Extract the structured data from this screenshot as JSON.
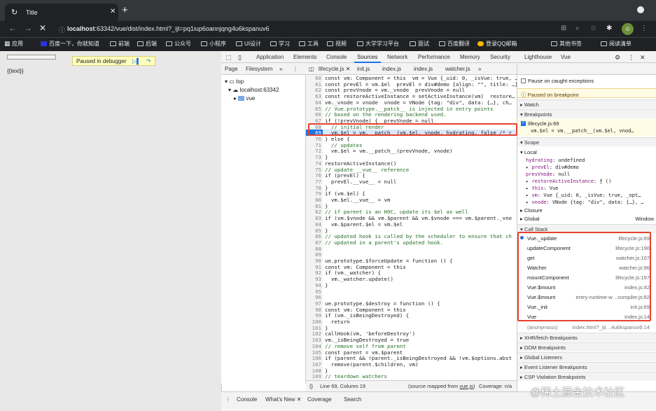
{
  "browser": {
    "tab_title": "Title",
    "url_host": "localhost",
    "url_rest": ":63342/vue/dist/index.html?_ijt=pq1iup6oannjqng4u6kspanuv6",
    "bookmarks": [
      "应用",
      "百度一下，你就知道",
      "前端",
      "后端",
      "公众号",
      "小程序",
      "UI设计",
      "学习",
      "工具",
      "视频",
      "大学学习平台",
      "面试",
      "百度翻译",
      "登录QQ邮箱"
    ],
    "other_bookmarks": "其他书签",
    "reading_list": "阅读清单"
  },
  "page": {
    "paused_label": "Paused in debugger",
    "body_text": "{{text}}"
  },
  "devtools": {
    "tabs": [
      "Application",
      "Elements",
      "Console",
      "Sources",
      "Network",
      "Performance",
      "Memory",
      "Security",
      "Lighthouse",
      "Vue"
    ],
    "active_tab": "Sources",
    "nav_tabs": [
      "Page",
      "Filesystem"
    ],
    "file_tabs": [
      "lifecycle.js",
      "init.js",
      "index.js",
      "index.js",
      "watcher.js"
    ],
    "tree": {
      "top": "top",
      "host": "localhost:63342",
      "folder": "vue"
    },
    "code_lines": [
      {
        "n": "60",
        "t": "const vm: Component = this  vm = Vue {_uid: 0, _isVue: true, …}"
      },
      {
        "n": "61",
        "t": "const prevEl = vm.$el  prevEl = div#demo {align: \"\", title: …}"
      },
      {
        "n": "62",
        "t": "const prevVnode = vm._vnode  prevVnode = null"
      },
      {
        "n": "63",
        "t": "const restoreActiveInstance = setActiveInstance(vm)  restore…"
      },
      {
        "n": "64",
        "t": "vm._vnode = vnode  vnode = VNode {tag: \"div\", data: {…}, ch…"
      },
      {
        "n": "65",
        "t": "// Vue.prototype.__patch__ is injected in entry points"
      },
      {
        "n": "66",
        "t": "// based on the rendering backend used."
      },
      {
        "n": "67",
        "t": "if (!prevVnode) {  prevVnode = null"
      },
      {
        "n": "68",
        "t": "  // initial render"
      },
      {
        "n": "69",
        "t": "  vm.$el = vm.__patch__(vm.$el, vnode, hydrating, false /* r"
      },
      {
        "n": "70",
        "t": "} else {"
      },
      {
        "n": "71",
        "t": "  // updates"
      },
      {
        "n": "72",
        "t": "  vm.$el = vm.__patch__(prevVnode, vnode)"
      },
      {
        "n": "73",
        "t": "}"
      },
      {
        "n": "74",
        "t": "restoreActiveInstance()"
      },
      {
        "n": "75",
        "t": "// update __vue__ reference"
      },
      {
        "n": "76",
        "t": "if (prevEl) {"
      },
      {
        "n": "77",
        "t": "  prevEl.__vue__ = null"
      },
      {
        "n": "78",
        "t": "}"
      },
      {
        "n": "79",
        "t": "if (vm.$el) {"
      },
      {
        "n": "80",
        "t": "  vm.$el.__vue__ = vm"
      },
      {
        "n": "81",
        "t": "}"
      },
      {
        "n": "82",
        "t": "// if parent is an HOC, update its $el as well"
      },
      {
        "n": "83",
        "t": "if (vm.$vnode && vm.$parent && vm.$vnode === vm.$parent._vno"
      },
      {
        "n": "84",
        "t": "  vm.$parent.$el = vm.$el"
      },
      {
        "n": "85",
        "t": "}"
      },
      {
        "n": "86",
        "t": "// updated hook is called by the scheduler to ensure that ch"
      },
      {
        "n": "87",
        "t": "// updated in a parent's updated hook."
      },
      {
        "n": "88",
        "t": ""
      },
      {
        "n": "89",
        "t": ""
      },
      {
        "n": "90",
        "t": "ue.prototype.$forceUpdate = function () {"
      },
      {
        "n": "91",
        "t": "const vm: Component = this"
      },
      {
        "n": "92",
        "t": "if (vm._watcher) {"
      },
      {
        "n": "93",
        "t": "  vm._watcher.update()"
      },
      {
        "n": "94",
        "t": "}"
      },
      {
        "n": "95",
        "t": ""
      },
      {
        "n": "96",
        "t": ""
      },
      {
        "n": "97",
        "t": "ue.prototype.$destroy = function () {"
      },
      {
        "n": "98",
        "t": "const vm: Component = this"
      },
      {
        "n": "99",
        "t": "if (vm._isBeingDestroyed) {"
      },
      {
        "n": "100",
        "t": "  return"
      },
      {
        "n": "101",
        "t": "}"
      },
      {
        "n": "102",
        "t": "callHook(vm, 'beforeDestroy')"
      },
      {
        "n": "103",
        "t": "vm._isBeingDestroyed = true"
      },
      {
        "n": "104",
        "t": "// remove self from parent"
      },
      {
        "n": "105",
        "t": "const parent = vm.$parent"
      },
      {
        "n": "106",
        "t": "if (parent && !parent._isBeingDestroyed && !vm.$options.abst"
      },
      {
        "n": "107",
        "t": "  remove(parent.$children, vm)"
      },
      {
        "n": "108",
        "t": "}"
      },
      {
        "n": "109",
        "t": "// teardown watchers"
      },
      {
        "n": "110",
        "t": "if (vm._watcher) {"
      },
      {
        "n": "111",
        "t": "  vm._watcher.teardown()"
      },
      {
        "n": "112",
        "t": "}"
      }
    ],
    "status": {
      "braces": "{}",
      "position": "Line 69, Column 19",
      "mapped": "(source mapped from ",
      "mapped_link": "vue.js",
      "mapped_end": ")",
      "coverage": "Coverage: n/a"
    },
    "right": {
      "pause_on_caught": "Pause on caught exceptions",
      "paused_on": "Paused on breakpoint",
      "watch": "Watch",
      "breakpoints": "Breakpoints",
      "bp_file": "lifecycle.js:69",
      "bp_code": "vm.$el = vm.__patch__(vm.$el, vnod…",
      "scope": "Scope",
      "local": "Local",
      "scope_items": [
        {
          "k": "hydrating",
          "v": ": undefined",
          "arrow": " "
        },
        {
          "k": "prevEl",
          "v": ": div#demo",
          "arrow": "▸"
        },
        {
          "k": "prevVnode",
          "v": ": null",
          "arrow": " "
        },
        {
          "k": "restoreActiveInstance",
          "v": ": ƒ ()",
          "arrow": "▸"
        },
        {
          "k": "this",
          "v": ": Vue",
          "arrow": "▸"
        },
        {
          "k": "vm",
          "v": ": Vue {_uid: 0, _isVue: true, _opt…",
          "arrow": "▸"
        },
        {
          "k": "vnode",
          "v": ": VNode {tag: \"div\", data: {…}, …",
          "arrow": "▸"
        }
      ],
      "closure": "Closure",
      "global": "Global",
      "global_val": "Window",
      "call_stack": "Call Stack",
      "frames": [
        {
          "fn": "Vue._update",
          "loc": "lifecycle.js:69"
        },
        {
          "fn": "updateComponent",
          "loc": "lifecycle.js:190"
        },
        {
          "fn": "get",
          "loc": "watcher.js:107"
        },
        {
          "fn": "Watcher",
          "loc": "watcher.js:96"
        },
        {
          "fn": "mountComponent",
          "loc": "lifecycle.js:197"
        },
        {
          "fn": "Vue.$mount",
          "loc": "index.js:42"
        },
        {
          "fn": "Vue.$mount",
          "loc": "entry-runtime-w…compiler.js:82"
        },
        {
          "fn": "Vue._init",
          "loc": "init.js:69"
        },
        {
          "fn": "Vue",
          "loc": "index.js:14"
        }
      ],
      "anon": "(anonymous)",
      "anon_loc": "index.html?_ijt…4u6kspanuv6:14",
      "more_sections": [
        "XHR/fetch Breakpoints",
        "DOM Breakpoints",
        "Global Listeners",
        "Event Listener Breakpoints",
        "CSP Violation Breakpoints"
      ]
    },
    "drawer": [
      "Console",
      "What's New",
      "Coverage",
      "Search"
    ]
  },
  "watermark": "@稀土掘金技术社区",
  "colors": {
    "accent": "#1a73e8",
    "highlight_box": "#e8412d"
  }
}
